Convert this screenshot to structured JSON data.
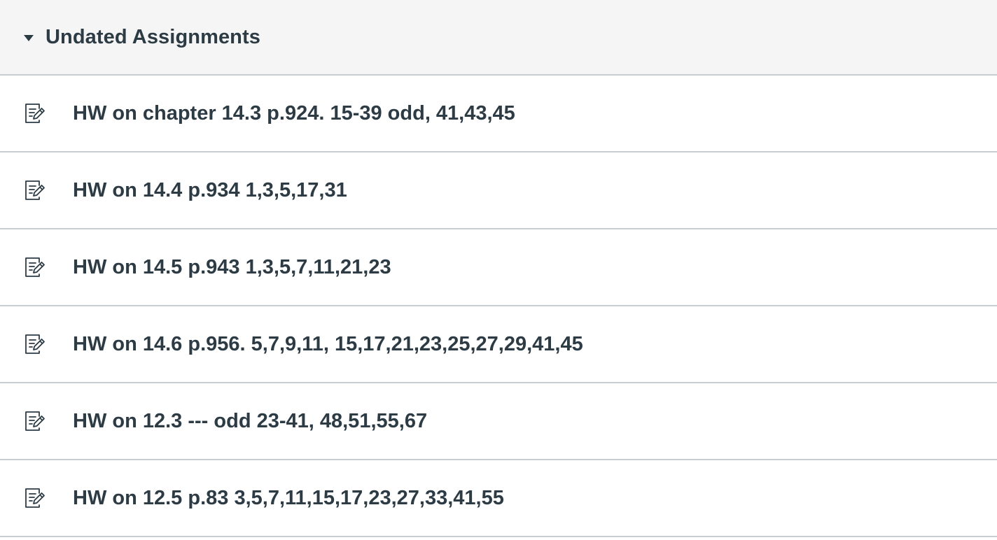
{
  "group": {
    "title": "Undated Assignments",
    "expanded": true,
    "caret_icon": "caret-down-icon"
  },
  "assignments": [
    {
      "title": "HW on chapter 14.3 p.924. 15-39 odd, 41,43,45",
      "icon": "assignment-icon"
    },
    {
      "title": "HW on 14.4 p.934 1,3,5,17,31",
      "icon": "assignment-icon"
    },
    {
      "title": "HW on 14.5 p.943 1,3,5,7,11,21,23",
      "icon": "assignment-icon"
    },
    {
      "title": "HW on 14.6 p.956. 5,7,9,11, 15,17,21,23,25,27,29,41,45",
      "icon": "assignment-icon"
    },
    {
      "title": "HW on 12.3 --- odd 23-41, 48,51,55,67",
      "icon": "assignment-icon"
    },
    {
      "title": "HW on 12.5 p.83 3,5,7,11,15,17,23,27,33,41,55",
      "icon": "assignment-icon"
    }
  ],
  "colors": {
    "text": "#2d3b45",
    "header_bg": "#f5f5f5",
    "divider": "#c7cdd1"
  }
}
